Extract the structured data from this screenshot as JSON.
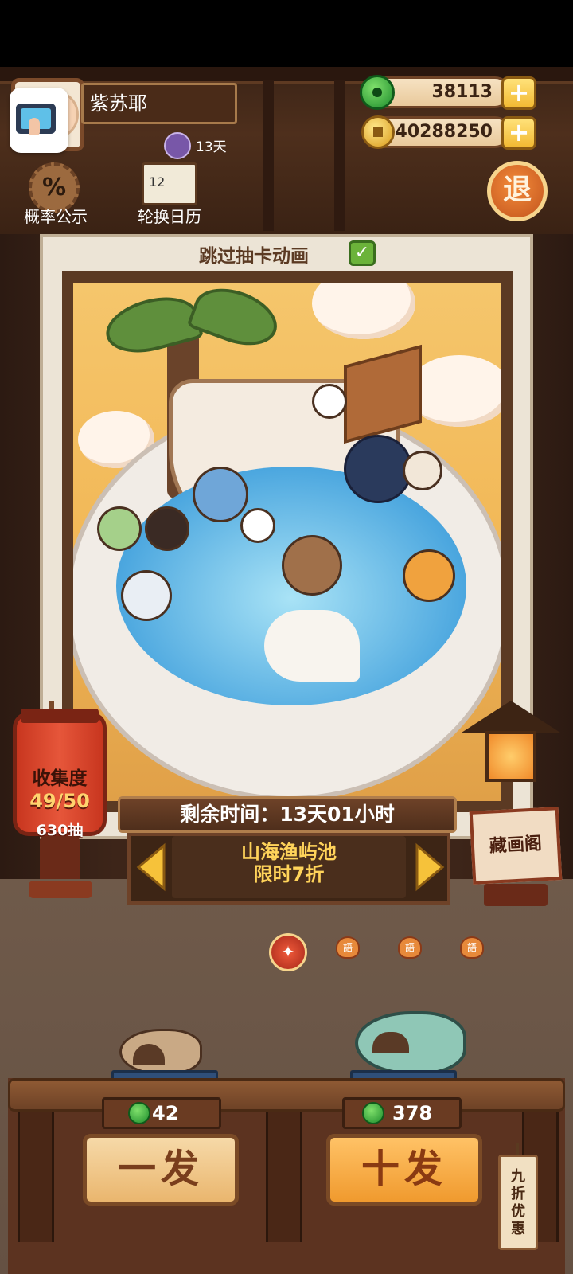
{
  "player": {
    "name": "紫苏耶",
    "days": "13天"
  },
  "resources": {
    "jade": "38113",
    "coins": "40288250"
  },
  "menu": {
    "probability_label": "概率公示",
    "probability_icon_text": "%",
    "calendar_label": "轮换日历",
    "calendar_icon_text": "12",
    "exit_label": "退"
  },
  "skip_animation": {
    "label": "跳过抽卡动画",
    "checked": true
  },
  "collection": {
    "title": "收集度",
    "progress": "49/50",
    "draws": "630抽"
  },
  "banner": {
    "remaining_time": "剩余时间：13天01小时",
    "pool_name": "山海渔屿池",
    "discount": "限时7折"
  },
  "gallery": {
    "label": "藏画阁"
  },
  "pool_selector": {
    "selected_index": 0,
    "count": 4,
    "lamp_glyph": "語"
  },
  "draw": {
    "single_label": "一发",
    "single_cost": "42",
    "ten_label": "十发",
    "ten_cost": "378",
    "discount_tag": "九折优惠"
  },
  "colors": {
    "accent_gold": "#ffd35a",
    "jade_green": "#1d8c2c",
    "wood_dark": "#3d2515"
  }
}
